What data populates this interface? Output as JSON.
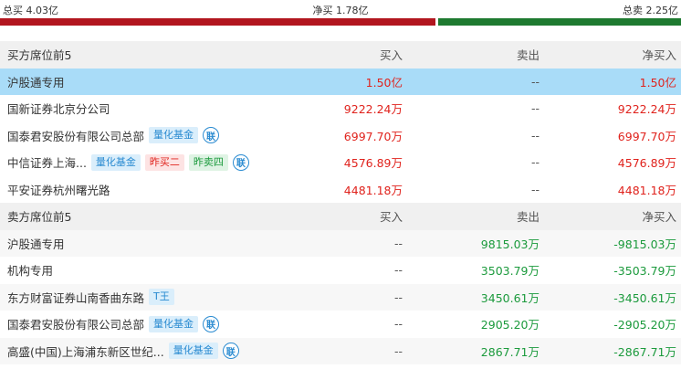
{
  "summary": {
    "total_buy": "总买 4.03亿",
    "net_buy": "净买 1.78亿",
    "total_sell": "总卖 2.25亿",
    "buy_fraction": 0.642
  },
  "buy_section": {
    "header": {
      "name": "买方席位前5",
      "buy": "买入",
      "sell": "卖出",
      "net": "净买入"
    },
    "rows": [
      {
        "name": "沪股通专用",
        "buy": "1.50亿",
        "sell": "--",
        "net": "1.50亿",
        "tags": [],
        "lian": ""
      },
      {
        "name": "国新证券北京分公司",
        "buy": "9222.24万",
        "sell": "--",
        "net": "9222.24万",
        "tags": [],
        "lian": ""
      },
      {
        "name": "国泰君安股份有限公司总部",
        "buy": "6997.70万",
        "sell": "--",
        "net": "6997.70万",
        "tags": [
          {
            "text": "量化基金",
            "style": "blue"
          }
        ],
        "lian": "联"
      },
      {
        "name": "中信证券上海...",
        "buy": "4576.89万",
        "sell": "--",
        "net": "4576.89万",
        "tags": [
          {
            "text": "量化基金",
            "style": "blue"
          },
          {
            "text": "昨买二",
            "style": "red"
          },
          {
            "text": "昨卖四",
            "style": "green"
          }
        ],
        "lian": "联"
      },
      {
        "name": "平安证券杭州曙光路",
        "buy": "4481.18万",
        "sell": "--",
        "net": "4481.18万",
        "tags": [],
        "lian": ""
      }
    ]
  },
  "sell_section": {
    "header": {
      "name": "卖方席位前5",
      "buy": "买入",
      "sell": "卖出",
      "net": "净买入"
    },
    "rows": [
      {
        "name": "沪股通专用",
        "buy": "--",
        "sell": "9815.03万",
        "net": "-9815.03万",
        "tags": [],
        "lian": ""
      },
      {
        "name": "机构专用",
        "buy": "--",
        "sell": "3503.79万",
        "net": "-3503.79万",
        "tags": [],
        "lian": ""
      },
      {
        "name": "东方财富证券山南香曲东路",
        "buy": "--",
        "sell": "3450.61万",
        "net": "-3450.61万",
        "tags": [
          {
            "text": "T王",
            "style": "blue"
          }
        ],
        "lian": ""
      },
      {
        "name": "国泰君安股份有限公司总部",
        "buy": "--",
        "sell": "2905.20万",
        "net": "-2905.20万",
        "tags": [
          {
            "text": "量化基金",
            "style": "blue"
          }
        ],
        "lian": "联"
      },
      {
        "name": "高盛(中国)上海浦东新区世纪...",
        "buy": "--",
        "sell": "2867.71万",
        "net": "-2867.71万",
        "tags": [
          {
            "text": "量化基金",
            "style": "blue"
          }
        ],
        "lian": "联"
      }
    ]
  },
  "colors": {
    "buy": "#e0231d",
    "sell": "#1b9a3c",
    "highlight": "#a9dcf8",
    "buy_bar": "#b2161f",
    "sell_bar": "#1e7a30"
  }
}
